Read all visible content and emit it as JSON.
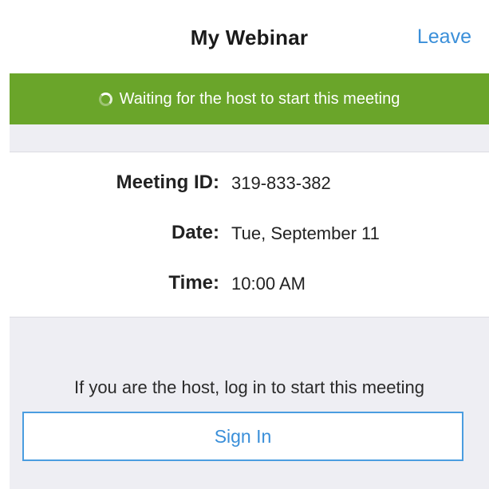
{
  "header": {
    "title": "My Webinar",
    "leave_label": "Leave"
  },
  "status": {
    "icon": "spinner-icon",
    "text": "Waiting for the host to start this meeting",
    "color": "#6aa52a"
  },
  "meeting": {
    "id_label": "Meeting ID:",
    "id_value": "319-833-382",
    "date_label": "Date:",
    "date_value": "Tue, September 11",
    "time_label": "Time:",
    "time_value": "10:00 AM"
  },
  "host": {
    "prompt": "If you are the host, log in to start this meeting",
    "signin_label": "Sign In"
  },
  "colors": {
    "accent": "#3a8fd9",
    "banner": "#6aa52a",
    "background": "#eeeef3"
  }
}
